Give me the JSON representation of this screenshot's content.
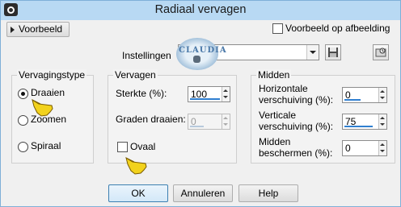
{
  "window": {
    "title": "Radiaal vervagen"
  },
  "top": {
    "preview_button": "Voorbeeld",
    "preview_on_image_label": "Voorbeeld op afbeelding",
    "preview_on_image_checked": false
  },
  "settings": {
    "label": "Instellingen",
    "combo_value": "",
    "logo_text": "CLAUDIA"
  },
  "type_group": {
    "title": "Vervagingstype",
    "options": [
      {
        "label": "Draaien",
        "selected": true
      },
      {
        "label": "Zoomen",
        "selected": false
      },
      {
        "label": "Spiraal",
        "selected": false
      }
    ]
  },
  "blur_group": {
    "title": "Vervagen",
    "strength_label": "Sterkte (%):",
    "strength_value": "100",
    "strength_fraction": 1.0,
    "twist_label": "Graden draaien:",
    "twist_value": "0",
    "twist_enabled": false,
    "oval_label": "Ovaal",
    "oval_checked": false
  },
  "center_group": {
    "title": "Midden",
    "h_label_1": "Horizontale",
    "h_label_2": "verschuiving (%):",
    "h_value": "0",
    "h_fraction": 0.5,
    "v_label_1": "Verticale",
    "v_label_2": "verschuiving (%):",
    "v_value": "75",
    "v_fraction": 0.875,
    "p_label_1": "Midden",
    "p_label_2": "beschermen (%):",
    "p_value": "0",
    "p_fraction": 0.0
  },
  "buttons": {
    "ok": "OK",
    "cancel": "Annuleren",
    "help": "Help"
  },
  "colors": {
    "titlebar": "#b8d9f3",
    "accent": "#2f7fd0",
    "hand": "#f2d21c"
  }
}
